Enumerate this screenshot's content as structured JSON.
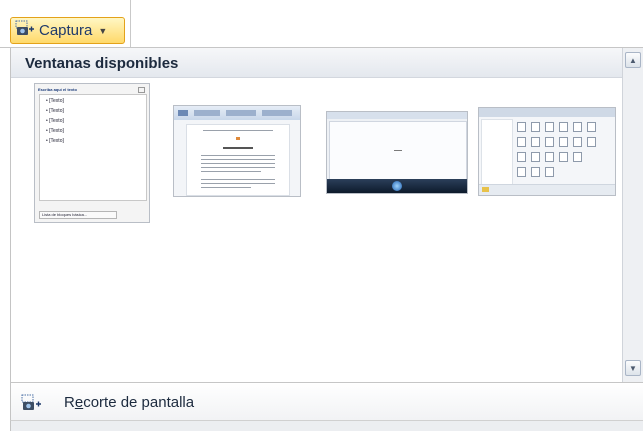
{
  "toolbar": {
    "capture_label": "Captura",
    "capture_icon": "screenshot-camera-icon",
    "dropdown_icon": "caret-down-icon"
  },
  "panel": {
    "title": "Ventanas disponibles"
  },
  "windows": [
    {
      "kind": "text-pane",
      "header": "Escriba aquí el texto",
      "items": [
        "[Texto]",
        "[Texto]",
        "[Texto]",
        "[Texto]",
        "[Texto]"
      ],
      "footer": "Lista de bloques básica..."
    },
    {
      "kind": "word-document"
    },
    {
      "kind": "media-window"
    },
    {
      "kind": "explorer-window"
    }
  ],
  "bottom": {
    "clip_pre": "R",
    "clip_underlined": "e",
    "clip_post": "corte de pantalla",
    "clip_icon": "screen-clipping-icon"
  },
  "colors": {
    "accent_border": "#e3a21a",
    "accent_fill": "#ffd96a",
    "label_text": "#1f3a6b"
  }
}
